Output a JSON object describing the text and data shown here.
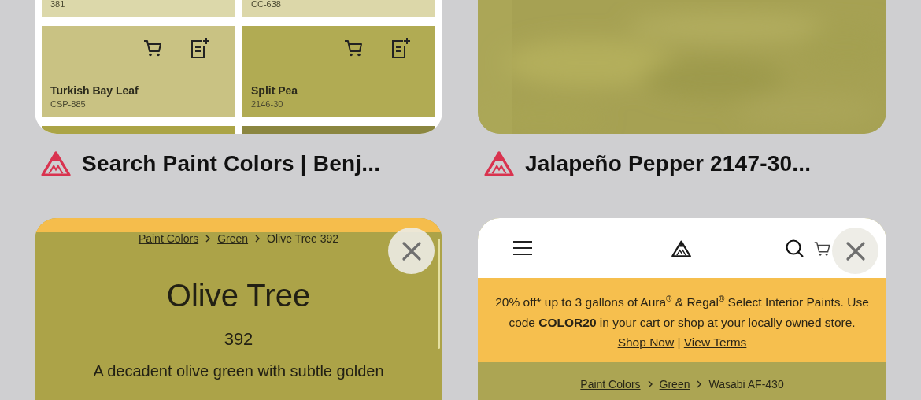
{
  "tabs": [
    {
      "kind": "swatch_grid",
      "title": "Search Paint Colors | Benj...",
      "swatches": [
        {
          "code": "381",
          "color": "#dcd8aa"
        },
        {
          "code": "CC-638",
          "color": "#dcd7a9"
        },
        {
          "name": "Turkish Bay Leaf",
          "code": "CSP-885",
          "color": "#c9c283"
        },
        {
          "name": "Split Pea",
          "code": "2146-30",
          "color": "#b1ab53"
        },
        {
          "color": "#aba446"
        },
        {
          "color": "#8b8640"
        }
      ]
    },
    {
      "kind": "picture",
      "title": "Jalapeño Pepper 2147-30..."
    },
    {
      "kind": "color_page",
      "closable": true,
      "color": "#aca348",
      "breadcrumb": [
        {
          "label": "Paint Colors",
          "link": true
        },
        {
          "label": "Green",
          "link": true
        },
        {
          "label": "Olive Tree 392",
          "link": false
        }
      ],
      "color_name": "Olive Tree",
      "color_number": "392",
      "description": "A decadent olive green with subtle golden"
    },
    {
      "kind": "color_page",
      "closable": true,
      "color": "#aca553",
      "header": true,
      "banner": {
        "text": "20% off* up to 3 gallons of Aura$^{®}$ & Regal$^{®}$ Select Interior Paints. Use code **COLOR20** in your cart or shop at your locally owned store.",
        "links": [
          "Shop Now",
          "View Terms"
        ],
        "separator": "|"
      },
      "breadcrumb": [
        {
          "label": "Paint Colors",
          "link": true
        },
        {
          "label": "Green",
          "link": true
        },
        {
          "label": "Wasabi AF-430",
          "link": false
        }
      ]
    }
  ]
}
